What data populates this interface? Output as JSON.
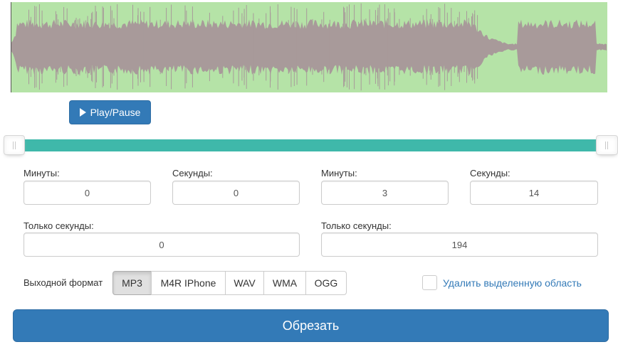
{
  "colors": {
    "waveform_bg": "#b5e3a7",
    "waveform_fill": "#a89a9a",
    "primary": "#337ab7",
    "slider": "#3fb8aa"
  },
  "player": {
    "play_pause_label": "Play/Pause",
    "icon": "play-icon"
  },
  "start": {
    "minutes_label": "Минуты:",
    "minutes_value": "0",
    "seconds_label": "Секунды:",
    "seconds_value": "0",
    "total_label": "Только секунды:",
    "total_value": "0"
  },
  "end": {
    "minutes_label": "Минуты:",
    "minutes_value": "3",
    "seconds_label": "Секунды:",
    "seconds_value": "14",
    "total_label": "Только секунды:",
    "total_value": "194"
  },
  "format": {
    "label": "Выходной формат",
    "options": [
      "MP3",
      "M4R IPhone",
      "WAV",
      "WMA",
      "OGG"
    ],
    "selected": "MP3"
  },
  "delete_region": {
    "label": "Удалить выделенную область",
    "checked": false
  },
  "cut_button": {
    "label": "Обрезать"
  }
}
